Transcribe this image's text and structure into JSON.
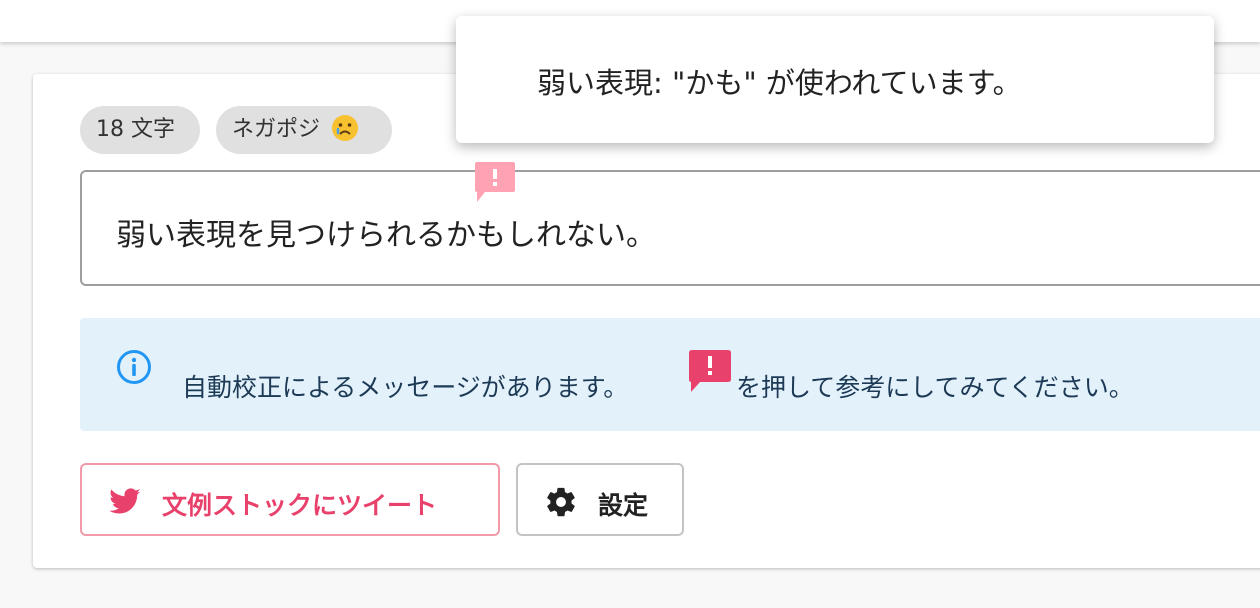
{
  "stats": {
    "char_count": "18 文字",
    "sentiment_label": "ネガポジ",
    "sentiment_icon": "sad-face-emoji"
  },
  "editor": {
    "text": "弱い表現を見つけられるかもしれない。",
    "warning_marker_icon": "exclamation-bubble-icon"
  },
  "tooltip": {
    "message": "弱い表現: \"かも\" が使われています。"
  },
  "info": {
    "icon": "info-circle-icon",
    "text_before": "自動校正によるメッセージがあります。",
    "marker_icon": "exclamation-bubble-icon",
    "text_after": "を押して参考にしてみてください。"
  },
  "buttons": {
    "tweet_label": "文例ストックにツイート",
    "tweet_icon": "twitter-bird-icon",
    "settings_label": "設定",
    "settings_icon": "gear-icon"
  },
  "colors": {
    "accent": "#e8416b",
    "marker_light": "#ffa3b4",
    "info_bg": "#e3f1fb",
    "info_icon": "#2196f3"
  }
}
